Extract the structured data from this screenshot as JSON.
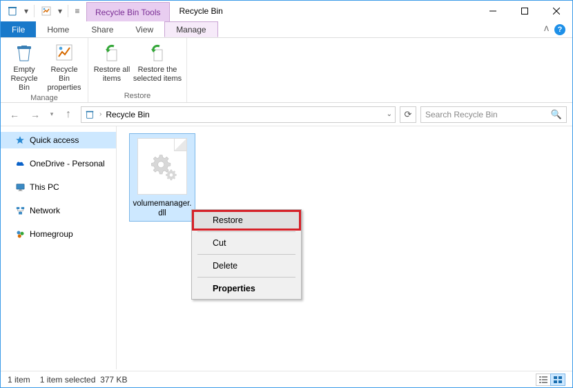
{
  "window": {
    "tools_tab": "Recycle Bin Tools",
    "title": "Recycle Bin"
  },
  "tabs": {
    "file": "File",
    "home": "Home",
    "share": "Share",
    "view": "View",
    "manage": "Manage"
  },
  "ribbon": {
    "empty": "Empty Recycle Bin",
    "props": "Recycle Bin properties",
    "restore_all": "Restore all items",
    "restore_sel": "Restore the selected items",
    "group_manage": "Manage",
    "group_restore": "Restore"
  },
  "nav": {
    "location": "Recycle Bin",
    "search_placeholder": "Search Recycle Bin"
  },
  "sidebar": {
    "items": [
      {
        "label": "Quick access"
      },
      {
        "label": "OneDrive - Personal"
      },
      {
        "label": "This PC"
      },
      {
        "label": "Network"
      },
      {
        "label": "Homegroup"
      }
    ]
  },
  "file": {
    "name": "volumemanager.dll"
  },
  "context_menu": {
    "restore": "Restore",
    "cut": "Cut",
    "delete": "Delete",
    "properties": "Properties"
  },
  "status": {
    "count": "1 item",
    "selected": "1 item selected",
    "size": "377 KB"
  }
}
